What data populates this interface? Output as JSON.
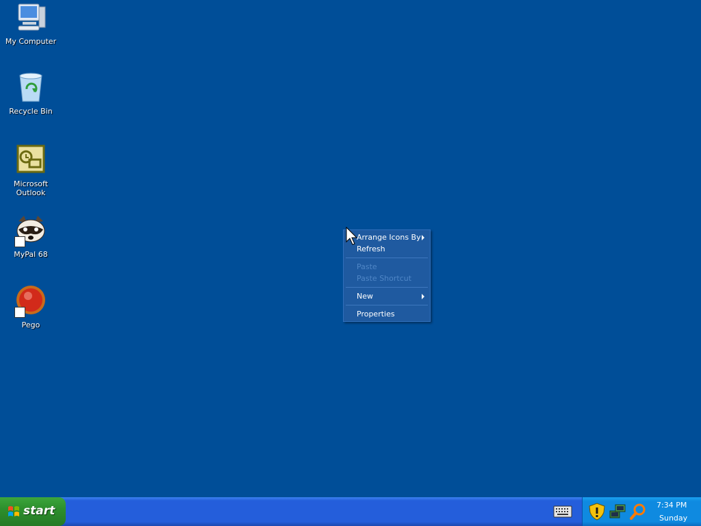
{
  "desktop": {
    "background_color": "#004E98",
    "icons": [
      {
        "label": "My Computer",
        "icon": "computer-icon"
      },
      {
        "label": "Recycle Bin",
        "icon": "recycle-bin-icon"
      },
      {
        "label": "Microsoft Outlook",
        "icon": "outlook-icon"
      },
      {
        "label": "MyPal 68",
        "icon": "mypal-icon"
      },
      {
        "label": "Pego",
        "icon": "pego-icon"
      }
    ]
  },
  "context_menu": {
    "items": [
      {
        "label": "Arrange Icons By",
        "enabled": true,
        "submenu": true
      },
      {
        "label": "Refresh",
        "enabled": true,
        "submenu": false
      },
      {
        "label": "Paste",
        "enabled": false,
        "submenu": false
      },
      {
        "label": "Paste Shortcut",
        "enabled": false,
        "submenu": false
      },
      {
        "label": "New",
        "enabled": true,
        "submenu": true
      },
      {
        "label": "Properties",
        "enabled": true,
        "submenu": false
      }
    ]
  },
  "taskbar": {
    "start_label": "start",
    "tray_icons": [
      "security-shield-icon",
      "network-icon",
      "search-icon"
    ],
    "clock_time": "7:34 PM",
    "clock_day": "Sunday"
  },
  "colors": {
    "taskbar_blue": "#245EDB",
    "start_green": "#2D8F2D",
    "tray_blue": "#0F8AE0"
  }
}
